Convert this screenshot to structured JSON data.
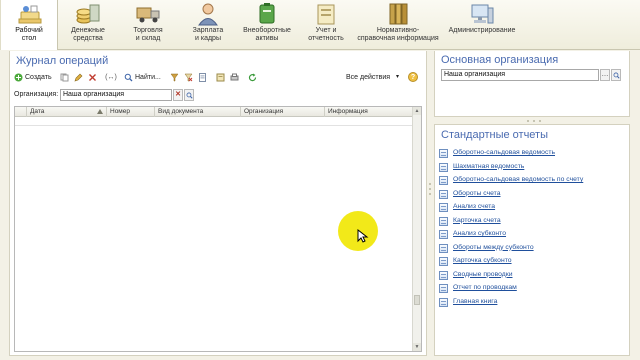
{
  "sections": [
    {
      "label": "Рабочий\nстол",
      "icon": "desktop-icon",
      "active": true
    },
    {
      "label": "Денежные\nсредства",
      "icon": "coins-icon"
    },
    {
      "label": "Торговля\nи склад",
      "icon": "truck-icon"
    },
    {
      "label": "Зарплата\nи кадры",
      "icon": "person-icon"
    },
    {
      "label": "Внеоборотные\nактивы",
      "icon": "battery-icon"
    },
    {
      "label": "Учет и\nотчетность",
      "icon": "scales-icon"
    },
    {
      "label": "Нормативно-\nсправочная информация",
      "icon": "books-icon"
    },
    {
      "label": "Администрирование",
      "icon": "computer-icon"
    }
  ],
  "journal": {
    "title": "Журнал операций",
    "toolbar": {
      "create": "Создать",
      "find": "Найти...",
      "all_actions": "Все действия",
      "help": "?"
    },
    "org_label": "Организация:",
    "org_value": "Наша организация",
    "columns": [
      "Дата",
      "Номер",
      "Вид документа",
      "Организация",
      "Информация"
    ]
  },
  "main_org": {
    "title": "Основная организация",
    "value": "Наша организация"
  },
  "reports": {
    "title": "Стандартные отчеты",
    "items": [
      "Оборотно-сальдовая ведомость",
      "Шахматная ведомость",
      "Оборотно-сальдовая ведомость по счету",
      "Обороты счета",
      "Анализ счета",
      "Карточка счета",
      "Анализ субконто",
      "Обороты между субконто",
      "Карточка субконто",
      "Сводные проводки",
      "Отчет по проводкам",
      "Главная книга"
    ]
  },
  "colors": {
    "title_blue": "#4a6bb0",
    "link_blue": "#1f4f9c",
    "cursor_highlight": "#f1e80d"
  }
}
